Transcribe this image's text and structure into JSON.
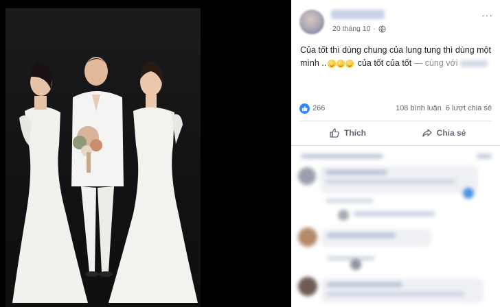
{
  "post": {
    "date": "20 tháng 10",
    "separator": "·",
    "text_line1": "Của tốt thì dùng chung của lung tung thì dùng một",
    "text_line2_start": "mình ..",
    "text_line2_end": "của tốt của tốt",
    "tagged_prefix": "— cùng với",
    "like_count": "266",
    "comments_count": "108 bình luận",
    "shares_count": "6 lượt chia sẻ",
    "like_label": "Thích",
    "share_label": "Chia sẻ",
    "more_label": "···"
  },
  "icons": {
    "globe": "globe-icon",
    "like": "thumbs-up-icon",
    "share": "share-arrow-icon",
    "more": "more-horizontal-icon"
  },
  "colors": {
    "facebook_blue": "#2d88ff",
    "text_primary": "#1c1e21",
    "text_secondary": "#65676b",
    "divider": "#dddfe2"
  }
}
